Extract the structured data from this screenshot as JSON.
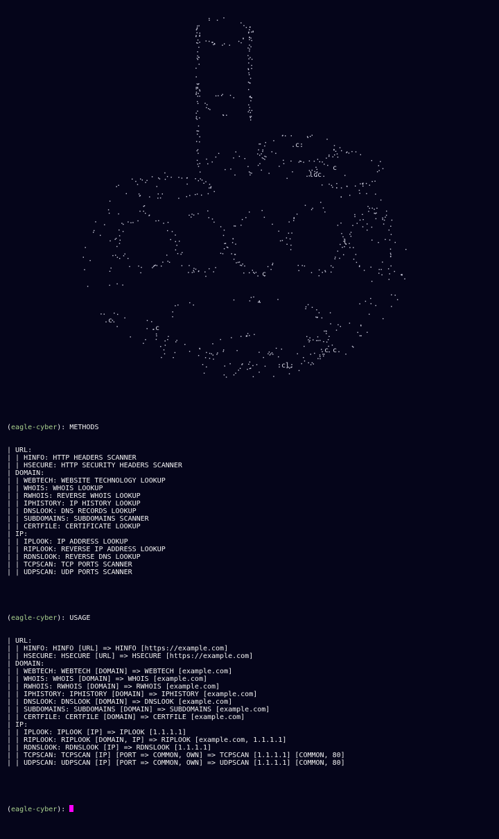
{
  "prompt": {
    "name": "eagle-cyber",
    "symbol": "):"
  },
  "methods_cmd": "METHODS",
  "usage_cmd": "USAGE",
  "methods_lines": [
    "| URL:",
    "| | HINFO: HTTP HEADERS SCANNER",
    "| | HSECURE: HTTP SECURITY HEADERS SCANNER",
    "| DOMAIN:",
    "| | WEBTECH: WEBSITE TECHNOLOGY LOOKUP",
    "| | WHOIS: WHOIS LOOKUP",
    "| | RWHOIS: REVERSE WHOIS LOOKUP",
    "| | IPHISTORY: IP HISTORY LOOKUP",
    "| | DNSLOOK: DNS RECORDS LOOKUP",
    "| | SUBDOMAINS: SUBDOMAINS SCANNER",
    "| | CERTFILE: CERTIFICATE LOOKUP",
    "| IP:",
    "| | IPLOOK: IP ADDRESS LOOKUP",
    "| | RIPLOOK: REVERSE IP ADDRESS LOOKUP",
    "| | RDNSLOOK: REVERSE DNS LOOKUP",
    "| | TCPSCAN: TCP PORTS SCANNER",
    "| | UDPSCAN: UDP PORTS SCANNER"
  ],
  "usage_lines": [
    "| URL:",
    "| | HINFO: HINFO [URL] => HINFO [https://example.com]",
    "| | HSECURE: HSECURE [URL] => HSECURE [https://example.com]",
    "| DOMAIN:",
    "| | WEBTECH: WEBTECH [DOMAIN] => WEBTECH [example.com]",
    "| | WHOIS: WHOIS [DOMAIN] => WHOIS [example.com]",
    "| | RWHOIS: RWHOIS [DOMAIN] => RWHOIS [example.com]",
    "| | IPHISTORY: IPHISTORY [DOMAIN] => IPHISTORY [example.com]",
    "| | DNSLOOK: DNSLOOK [DOMAIN] => DNSLOOK [example.com]",
    "| | SUBDOMAINS: SUBDOMAINS [DOMAIN] => SUBDOMAINS [example.com]",
    "| | CERTFILE: CERTFILE [DOMAIN] => CERTFILE [example.com]",
    "| IP:",
    "| | IPLOOK: IPLOOK [IP] => IPLOOK [1.1.1.1]",
    "| | RIPLOOK: RIPLOOK [DOMAIN, IP] => RIPLOOK [example.com, 1.1.1.1]",
    "| | RDNSLOOK: RDNSLOOK [IP] => RDNSLOOK [1.1.1.1]",
    "| | TCPSCAN: TCPSCAN [IP] [PORT => COMMON, OWN] => TCPSCAN [1.1.1.1] [COMMON, 80]",
    "| | UDPSCAN: UDPSCAN [IP] [PORT => COMMON, OWN] => UDPSCAN [1.1.1.1] [COMMON, 80]"
  ],
  "colors": {
    "background": "#05051a",
    "text": "#f2f2f2",
    "prompt": "#a9d18e",
    "cursor": "#ff00ff"
  }
}
